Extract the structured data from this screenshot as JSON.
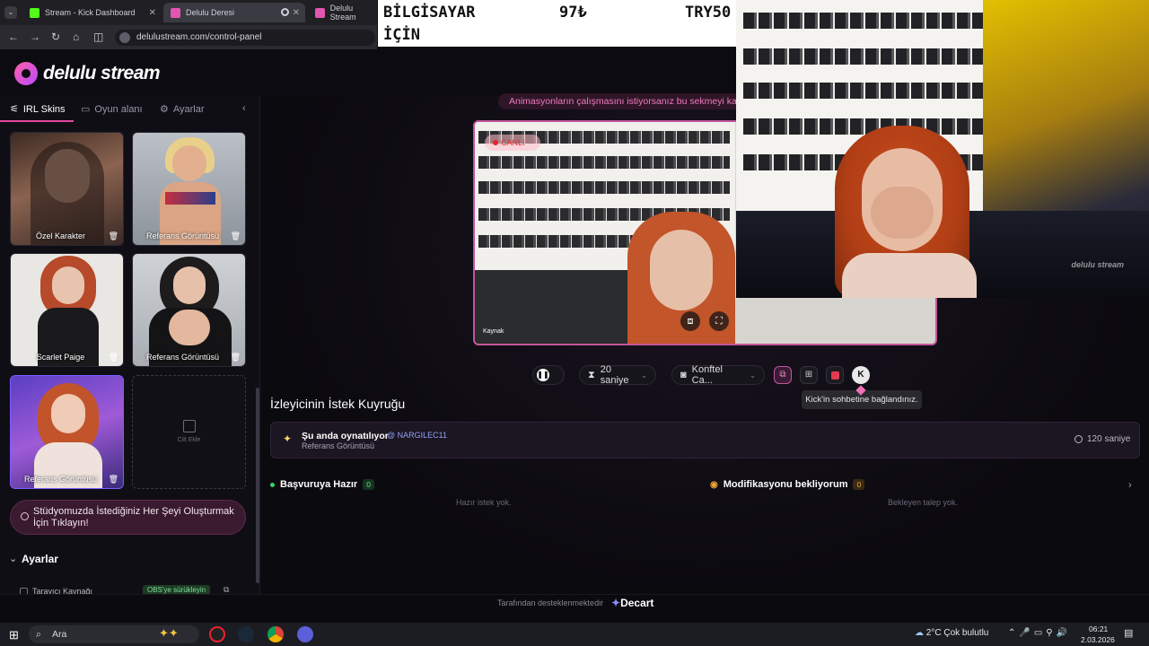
{
  "browser": {
    "tabs": [
      {
        "label": "Stream - Kick Dashboard",
        "color": "#53fc18"
      },
      {
        "label": "Delulu Deresi",
        "color": "#e256b0"
      },
      {
        "label": "Delulu Stream",
        "color": "#e256b0"
      }
    ],
    "url": "delulustream.com/control-panel"
  },
  "overlay_banner": {
    "word1": "BİLGİSAYAR",
    "word2": "İÇİN",
    "price1": "97₺",
    "price2": "TRY50"
  },
  "app": {
    "logo": "delulu stream"
  },
  "sidebar": {
    "tabs": [
      {
        "label": "IRL Skins",
        "icon": "sliders-icon"
      },
      {
        "label": "Oyun alanı",
        "icon": "gamepad-icon"
      },
      {
        "label": "Ayarlar",
        "icon": "gear-icon"
      }
    ],
    "cards": [
      {
        "label": "Özel Karakter",
        "delete_icon": "🗑"
      },
      {
        "label": "Referans Görüntüsü",
        "delete_icon": "🗑"
      },
      {
        "label": "Scarlet Paige",
        "delete_icon": "🗑"
      },
      {
        "label": "Referans Görüntüsü",
        "delete_icon": "🗑"
      },
      {
        "label": "Referans Görüntüsü",
        "delete_icon": "🗑"
      }
    ],
    "add_card_label": "Cilt Ekle",
    "studio_cta": "Stüdyomuzda İstediğiniz Her Şeyi Oluşturmak İçin Tıklayın!",
    "settings_heading": "Ayarlar",
    "browser_source": "Tarayıcı Kaynağı",
    "obs_badge": "OBS'ye sürükleyin"
  },
  "main": {
    "anim_banner": "Animasyonların çalışmasını istiyorsanız bu sekmeyi ka",
    "live_label": "CANLI",
    "video_caption": "Kaynak",
    "watermark": "delulu stream",
    "controls": {
      "duration": "20 saniye",
      "camera": "Konftel Ca..."
    },
    "tooltip": "Kick'in sohbetine bağlandınız.",
    "queue_title": "İzleyicinin İstek Kuyruğu",
    "now_playing": {
      "title": "Şu anda oynatılıyor",
      "user": "@ NARGILEC11",
      "subtitle": "Referans Görüntüsü",
      "time": "120 saniye"
    },
    "ready": {
      "label": "Başvuruya Hazır",
      "count": "0",
      "empty": "Hazır istek yok."
    },
    "pending": {
      "label": "Modifikasyonu bekliyorum",
      "count": "0",
      "empty": "Bekleyen talep yok."
    },
    "footer": {
      "powered_by": "Tarafından desteklenmektedir",
      "brand": "Decart"
    }
  },
  "taskbar": {
    "search": "Ara",
    "weather": "2°C  Çok bulutlu",
    "time": "06:21",
    "date": "2.03.2026"
  }
}
